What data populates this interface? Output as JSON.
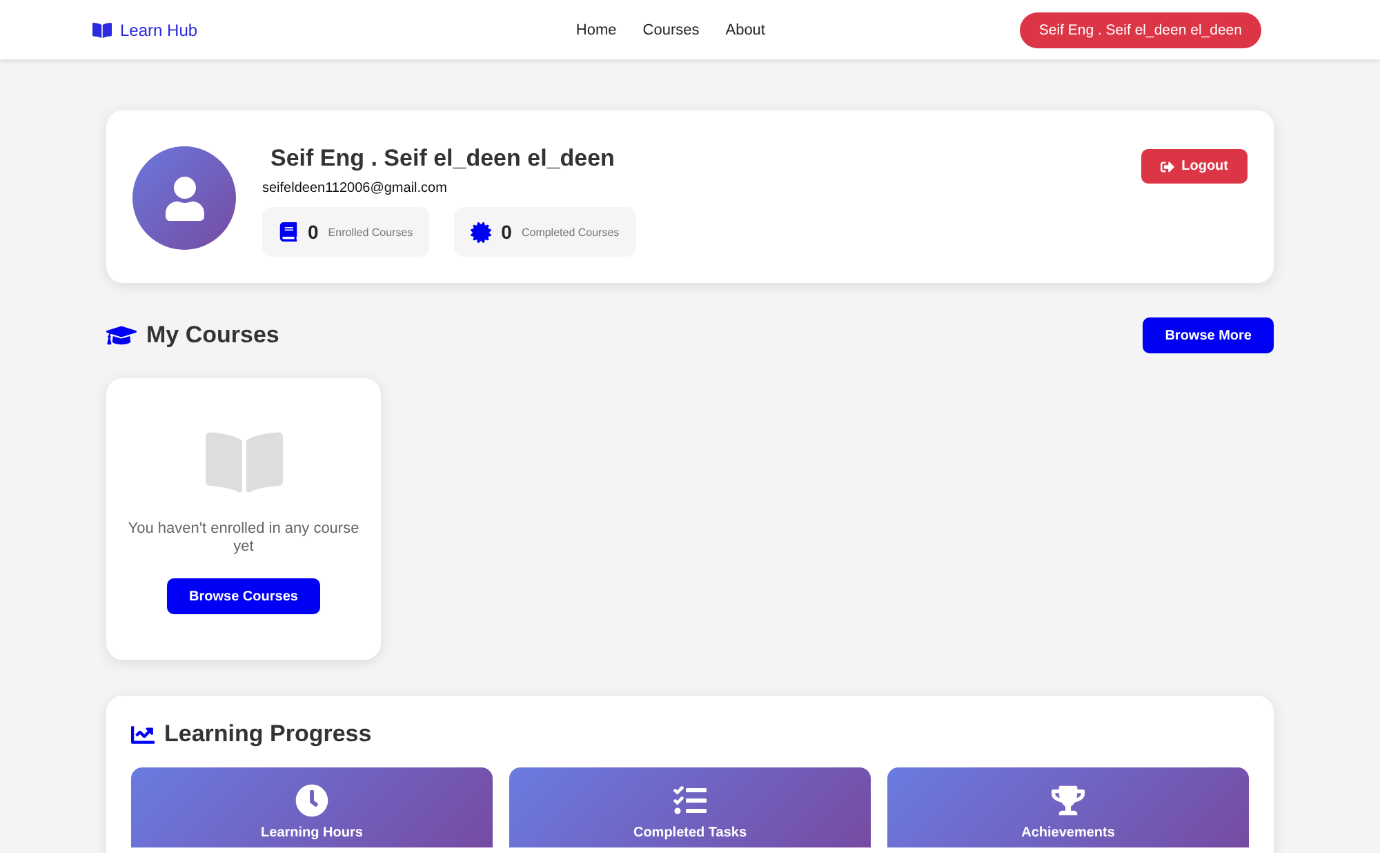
{
  "navbar": {
    "brand": "Learn Hub",
    "links": [
      {
        "label": "Home"
      },
      {
        "label": "Courses"
      },
      {
        "label": "About"
      }
    ],
    "user_button": "Seif Eng . Seif el_deen el_deen"
  },
  "profile": {
    "name": "Seif Eng . Seif el_deen el_deen",
    "email": "seifeldeen112006@gmail.com",
    "stats": [
      {
        "kind": "enrolled",
        "count": "0",
        "label": "Enrolled Courses"
      },
      {
        "kind": "completed",
        "count": "0",
        "label": "Completed Courses"
      }
    ],
    "logout": "Logout"
  },
  "my_courses": {
    "title": "My Courses",
    "browse_more": "Browse More",
    "empty_message": "You haven't enrolled in any course yet",
    "browse_courses": "Browse Courses"
  },
  "learning_progress": {
    "title": "Learning Progress",
    "tiles": [
      {
        "kind": "hours",
        "label": "Learning Hours"
      },
      {
        "kind": "tasks",
        "label": "Completed Tasks"
      },
      {
        "kind": "achievements",
        "label": "Achievements"
      }
    ]
  }
}
